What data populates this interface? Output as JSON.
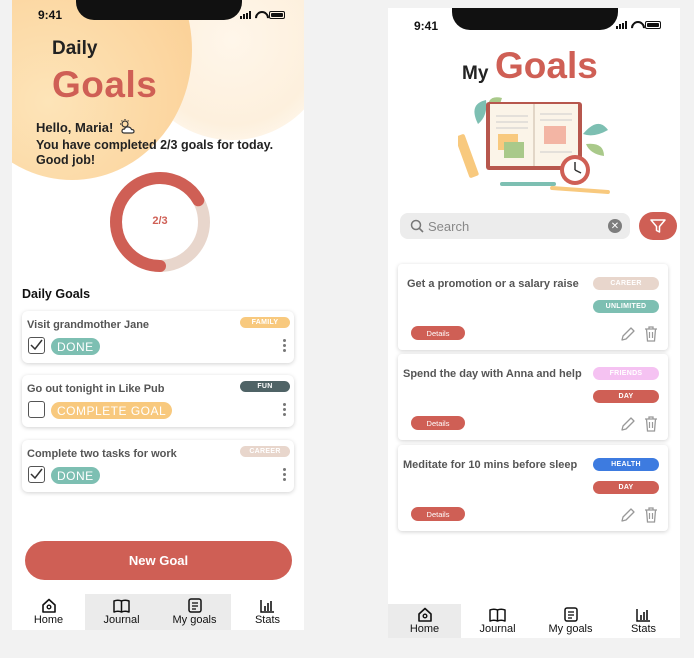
{
  "status": {
    "time_left": "9:41",
    "time_right": "9:41"
  },
  "left": {
    "header": {
      "daily": "Daily",
      "goals": "Goals"
    },
    "greeting": "Hello, Maria!",
    "summary": "You have completed 2/3 goals for today. Good job!",
    "progress": {
      "label": "2/3",
      "completed": 2,
      "total": 3
    },
    "section_title": "Daily Goals",
    "goals": [
      {
        "title": "Visit grandmother Jane",
        "tag": "FAMILY",
        "tag_color": "#f8c97e",
        "checked": true,
        "status": "DONE",
        "status_color": "#7dbfb2"
      },
      {
        "title": "Go out tonight in Like Pub",
        "tag": "FUN",
        "tag_color": "#4f6366",
        "checked": false,
        "status": "COMPLETE GOAL",
        "status_color": "#f8c97e"
      },
      {
        "title": "Complete two tasks for work",
        "tag": "CAREER",
        "tag_color": "#e8d6cc",
        "checked": true,
        "status": "DONE",
        "status_color": "#7dbfb2"
      }
    ],
    "new_goal_label": "New Goal",
    "tabs": [
      {
        "label": "Home",
        "icon": "home-icon"
      },
      {
        "label": "Journal",
        "icon": "book-icon"
      },
      {
        "label": "My goals",
        "icon": "list-icon"
      },
      {
        "label": "Stats",
        "icon": "chart-icon"
      }
    ]
  },
  "right": {
    "header": {
      "my": "My",
      "goals": "Goals"
    },
    "search": {
      "placeholder": "Search"
    },
    "goals": [
      {
        "title": "Get a promotion or a salary raise",
        "tags": [
          {
            "label": "CAREER",
            "color": "#e8d6cc"
          },
          {
            "label": "UNLIMITED",
            "color": "#7dbfb2"
          }
        ],
        "details": "Details"
      },
      {
        "title": "Spend the day with Anna and help",
        "tags": [
          {
            "label": "FRIENDS",
            "color": "#f5c2f2"
          },
          {
            "label": "DAY",
            "color": "#cf5f55"
          }
        ],
        "details": "Details"
      },
      {
        "title": "Meditate for 10 mins before sleep",
        "tags": [
          {
            "label": "HEALTH",
            "color": "#3d7be0"
          },
          {
            "label": "DAY",
            "color": "#cf5f55"
          }
        ],
        "details": "Details"
      }
    ],
    "tabs": [
      {
        "label": "Home",
        "icon": "home-icon"
      },
      {
        "label": "Journal",
        "icon": "book-icon"
      },
      {
        "label": "My goals",
        "icon": "list-icon"
      },
      {
        "label": "Stats",
        "icon": "chart-icon"
      }
    ]
  },
  "colors": {
    "accent": "#cf5f55",
    "ring_track": "#e8d6cc"
  }
}
